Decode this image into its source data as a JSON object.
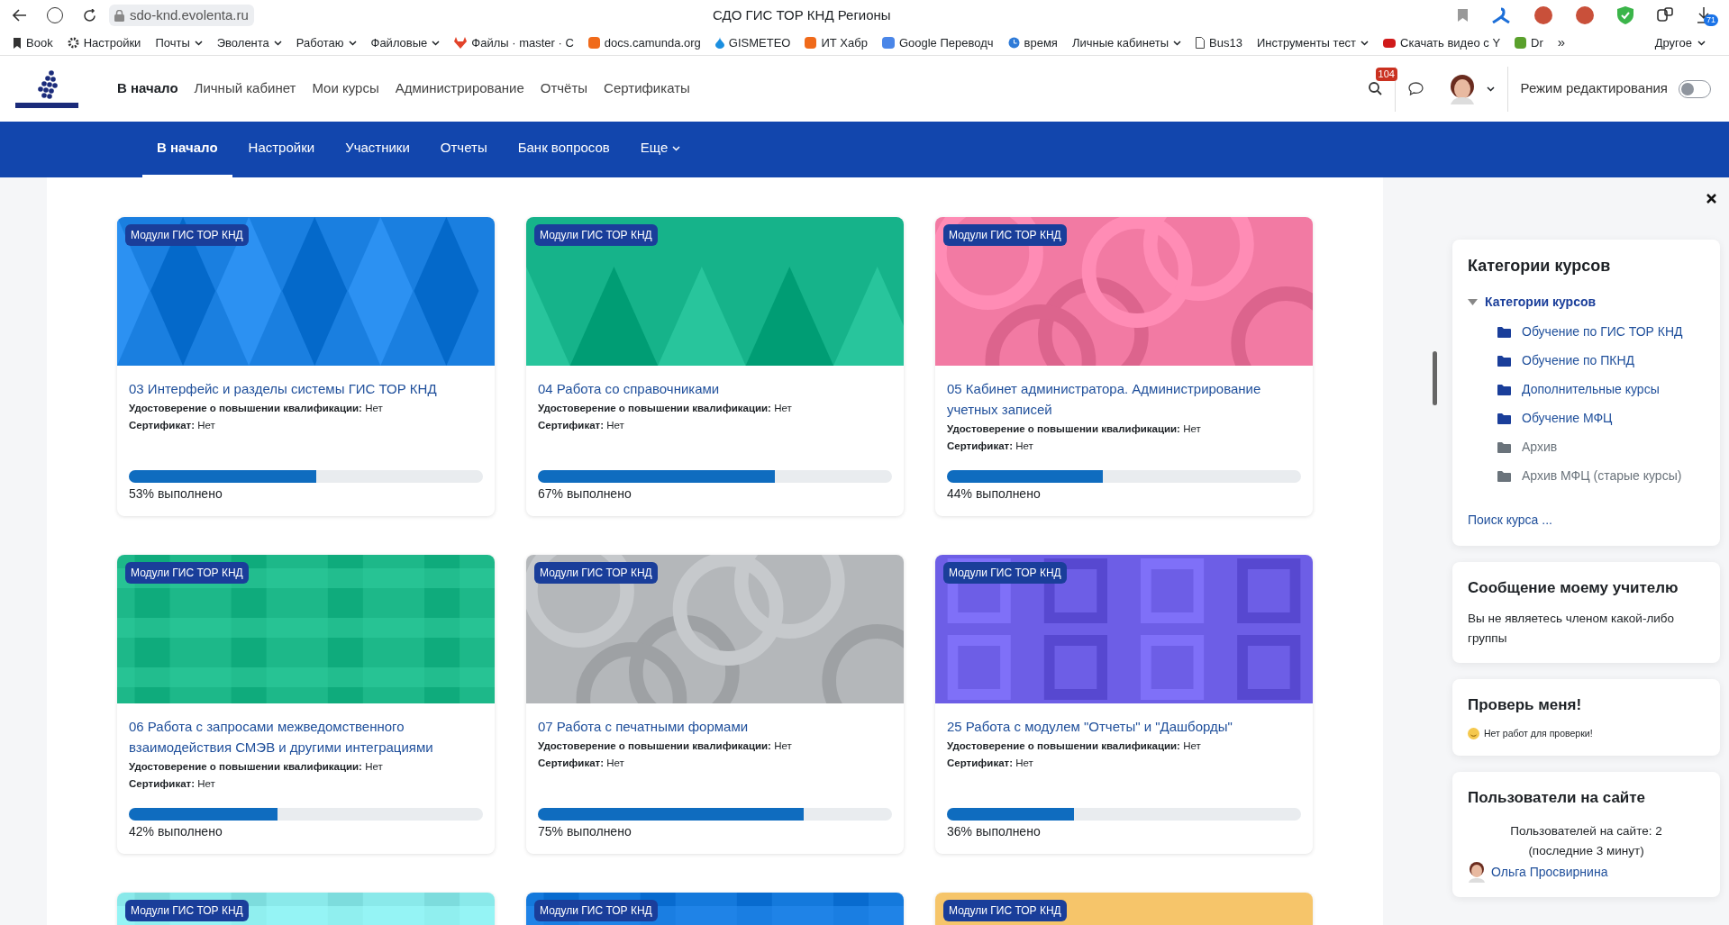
{
  "browser": {
    "url": "sdo-knd.evolenta.ru",
    "tab_title": "СДО ГИС ТОР КНД Регионы",
    "download_count": "71",
    "bookmarks": [
      {
        "label": "Book",
        "kind": "bookmark"
      },
      {
        "label": "Настройки",
        "kind": "gear"
      },
      {
        "label": "Почты",
        "kind": "folder"
      },
      {
        "label": "Эволента",
        "kind": "folder"
      },
      {
        "label": "Работаю",
        "kind": "folder"
      },
      {
        "label": "Файловые",
        "kind": "folder"
      },
      {
        "label": "Файлы · master · С",
        "kind": "fox"
      },
      {
        "label": "docs.camunda.org",
        "kind": "square"
      },
      {
        "label": "GISMETEO",
        "kind": "drop"
      },
      {
        "label": "ИТ Хабр",
        "kind": "square"
      },
      {
        "label": "Google Переводч",
        "kind": "translate"
      },
      {
        "label": "время",
        "kind": "clock"
      },
      {
        "label": "Личные кабинеты",
        "kind": "folder"
      },
      {
        "label": "Bus13",
        "kind": "page"
      },
      {
        "label": "Инструменты тест",
        "kind": "folder"
      },
      {
        "label": "Скачать видео с Y",
        "kind": "pre"
      },
      {
        "label": "Dr",
        "kind": "bug"
      }
    ],
    "more": "»",
    "other": "Другое"
  },
  "header": {
    "nav": [
      {
        "label": "В начало",
        "selected": true
      },
      {
        "label": "Личный кабинет",
        "selected": false
      },
      {
        "label": "Мои курсы",
        "selected": false
      },
      {
        "label": "Администрирование",
        "selected": false
      },
      {
        "label": "Отчёты",
        "selected": false
      },
      {
        "label": "Сертификаты",
        "selected": false
      }
    ],
    "notifications": "104",
    "edit_mode": {
      "label": "Режим редактирования",
      "on": false
    }
  },
  "course_nav": [
    {
      "label": "В начало",
      "selected": true,
      "menu": false
    },
    {
      "label": "Настройки",
      "selected": false,
      "menu": false
    },
    {
      "label": "Участники",
      "selected": false,
      "menu": false
    },
    {
      "label": "Отчеты",
      "selected": false,
      "menu": false
    },
    {
      "label": "Банк вопросов",
      "selected": false,
      "menu": false
    },
    {
      "label": "Еще",
      "selected": false,
      "menu": true
    }
  ],
  "courses": [
    {
      "category": "Модули ГИС ТОР КНД",
      "kind": "diamonds",
      "color": "#1a7fe0",
      "title": "03 Интерфейс и разделы системы ГИС ТОР КНД",
      "qualification": "**Удостоверение о повышении квалификации:** Нет",
      "certificate": "**Сертификат:** Нет",
      "level": 0.53,
      "progress": "53% выполнено"
    },
    {
      "category": "Модули ГИС ТОР КНД",
      "kind": "triangles",
      "color": "#16b38a",
      "title": "04 Работа со справочниками",
      "qualification": "**Удостоверение о повышении квалификации:** Нет",
      "certificate": "**Сертификат:** Нет",
      "level": 0.67,
      "progress": "67% выполнено"
    },
    {
      "category": "Модули ГИС ТОР КНД",
      "kind": "circles",
      "color": "#f27aa3",
      "title": "05 Кабинет администратора. Администрирование учетных записей",
      "qualification": "**Удостоверение о повышении квалификации:** Нет",
      "certificate": "**Сертификат:** Нет",
      "level": 0.44,
      "progress": "44% выполнено"
    },
    {
      "category": "Модули ГИС ТОР КНД",
      "kind": "plaid",
      "color": "#1db889",
      "title": "06 Работа с запросами межведомственного взаимодействия СМЭВ и другими интеграциями",
      "qualification": "**Удостоверение о повышении квалификации:** Нет",
      "certificate": "**Сертификат:** Нет",
      "level": 0.42,
      "progress": "42% выполнено"
    },
    {
      "category": "Модули ГИС ТОР КНД",
      "kind": "circles",
      "color": "#b4b7ba",
      "title": "07 Работа с печатными формами",
      "qualification": "**Удостоверение о повышении квалификации:** Нет",
      "certificate": "**Сертификат:** Нет",
      "level": 0.75,
      "progress": "75% выполнено"
    },
    {
      "category": "Модули ГИС ТОР КНД",
      "kind": "squares",
      "color": "#6d5ee6",
      "title": "25 Работа с модулем \"Отчеты\" и \"Дашборды\"",
      "qualification": "**Удостоверение о повышении квалификации:** Нет",
      "certificate": "**Сертификат:** Нет",
      "level": 0.36,
      "progress": "36% выполнено"
    },
    {
      "category": "Модули ГИС ТОР КНД",
      "kind": "plaid",
      "color": "#8ae9ea"
    },
    {
      "category": "Модули ГИС ТОР КНД",
      "kind": "plaid",
      "color": "#1479dc"
    },
    {
      "category": "Модули ГИС ТОР КНД",
      "kind": "triangles",
      "color": "#f6c56a"
    }
  ],
  "sidebar": {
    "categories": {
      "title": "Категории курсов",
      "root": {
        "label": "Категории курсов",
        "expanded": true,
        "children": [
          {
            "label": "Обучение по ГИС ТОР КНД",
            "disabled": false
          },
          {
            "label": "Обучение по ПКНД",
            "disabled": false
          },
          {
            "label": "Дополнительные курсы",
            "disabled": false
          },
          {
            "label": "Обучение МФЦ",
            "disabled": false
          },
          {
            "label": "Архив",
            "disabled": true
          },
          {
            "label": "Архив МФЦ (старые курсы)",
            "disabled": true
          }
        ]
      },
      "search_link": "Поиск курса ..."
    },
    "message": {
      "title": "Сообщение моему учителю",
      "text": "Вы не являетесь членом какой-либо группы"
    },
    "check": {
      "title": "Проверь меня!",
      "text": "Нет работ для проверки!"
    },
    "online": {
      "title": "Пользователи на сайте",
      "summary": "Пользователей на сайте: 2 (последние 3 минут)",
      "users": [
        "Ольга Просвирнина"
      ]
    }
  }
}
